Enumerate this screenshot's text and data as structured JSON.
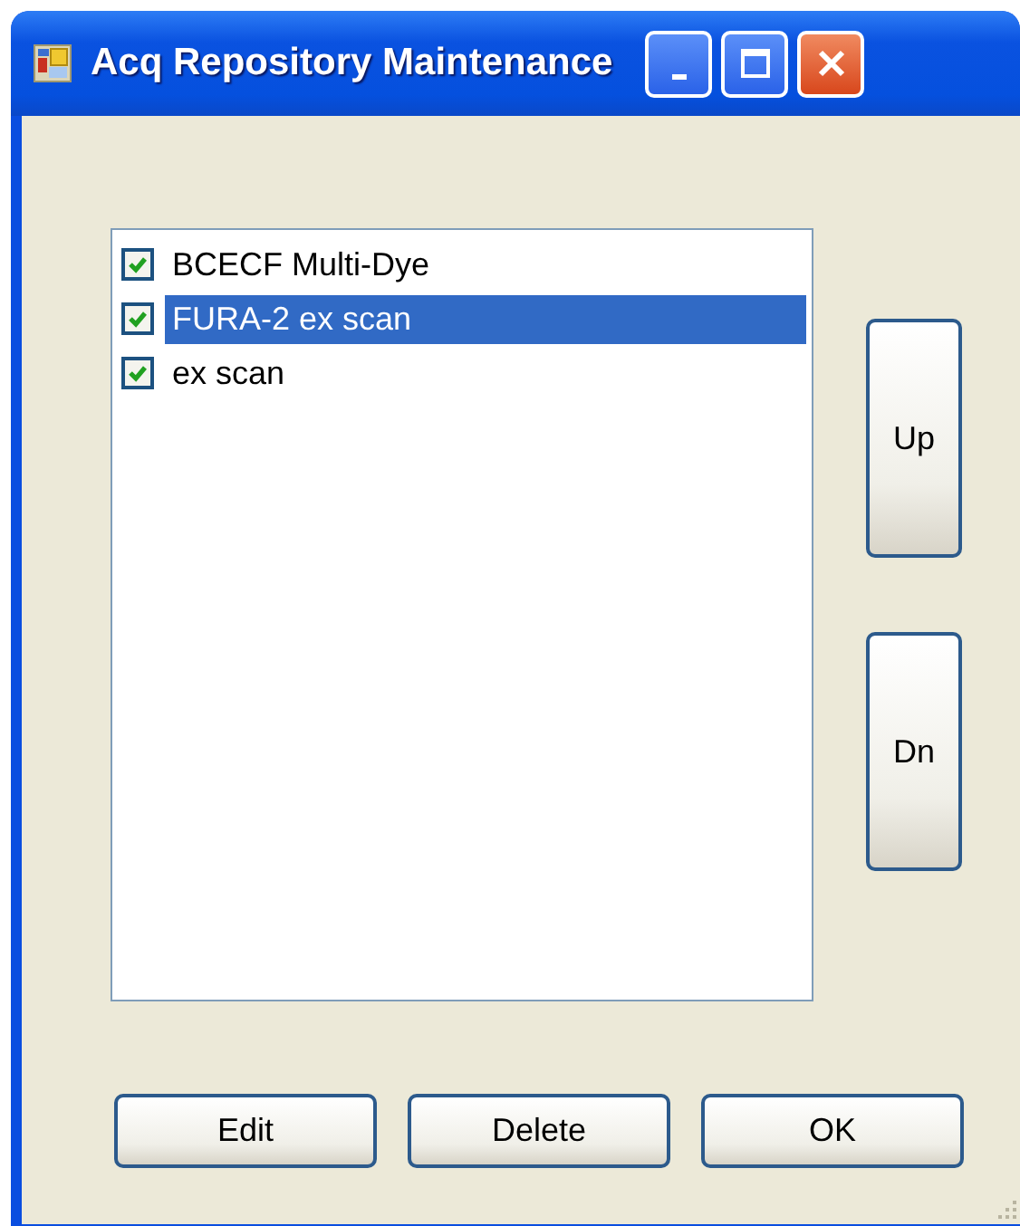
{
  "window": {
    "title": "Acq Repository Maintenance",
    "controls": [
      {
        "kind": "minimize"
      },
      {
        "kind": "maximize"
      },
      {
        "kind": "close"
      }
    ]
  },
  "list": {
    "items": [
      {
        "label": "BCECF Multi-Dye",
        "checked": true,
        "selected": false
      },
      {
        "label": "FURA-2 ex scan",
        "checked": true,
        "selected": true
      },
      {
        "label": "ex scan",
        "checked": true,
        "selected": false
      }
    ]
  },
  "side_buttons": [
    "Up",
    "Dn"
  ],
  "buttons": [
    "Edit",
    "Delete",
    "OK"
  ]
}
